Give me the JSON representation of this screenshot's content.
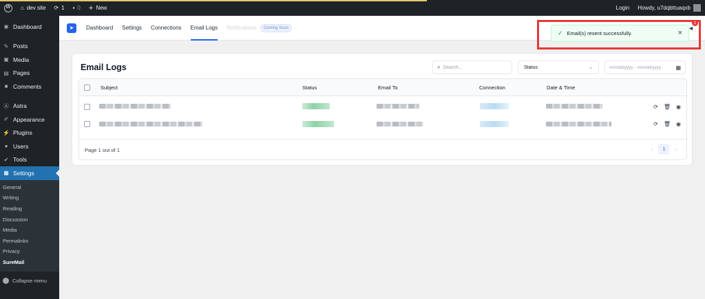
{
  "admin_bar": {
    "site_name": "dev site",
    "updates_count": "1",
    "comments_count": "0",
    "new_label": "New",
    "login_label": "Login",
    "howdy_text": "Howdy, u7dqbttuaqxb"
  },
  "sidebar": {
    "items": [
      {
        "label": "Dashboard",
        "icon": "dashboard-icon"
      },
      {
        "label": "Posts",
        "icon": "pin-icon"
      },
      {
        "label": "Media",
        "icon": "media-icon"
      },
      {
        "label": "Pages",
        "icon": "pages-icon"
      },
      {
        "label": "Comments",
        "icon": "comment-icon"
      },
      {
        "label": "Astra",
        "icon": "astra-icon"
      },
      {
        "label": "Appearance",
        "icon": "brush-icon"
      },
      {
        "label": "Plugins",
        "icon": "plug-icon"
      },
      {
        "label": "Users",
        "icon": "user-icon"
      },
      {
        "label": "Tools",
        "icon": "wrench-icon"
      },
      {
        "label": "Settings",
        "icon": "settings-icon"
      }
    ],
    "submenu": [
      "General",
      "Writing",
      "Reading",
      "Discussion",
      "Media",
      "Permalinks",
      "Privacy",
      "SureMail"
    ],
    "collapse_label": "Collapse menu"
  },
  "topnav": {
    "links": [
      "Dashboard",
      "Settings",
      "Connections",
      "Email Logs"
    ],
    "disabled_link": "Notifications",
    "badge": "Coming Soon"
  },
  "card": {
    "title": "Email Logs",
    "search_placeholder": "Search...",
    "status_select": "Status",
    "date_placeholder": "mm/dd/yyyy - mm/dd/yyyy"
  },
  "table": {
    "columns": [
      "Subject",
      "Status",
      "Email To",
      "Connection",
      "Date & Time"
    ],
    "page_info": "Page 1 out of 1",
    "current_page": "1"
  },
  "toast": {
    "message": "Email(s) resent successfully.",
    "notification_count": "1"
  },
  "colors": {
    "accent": "#2271b1",
    "plugin_accent": "#2563eb",
    "success": "#16a34a",
    "highlight_frame": "#e53935"
  }
}
